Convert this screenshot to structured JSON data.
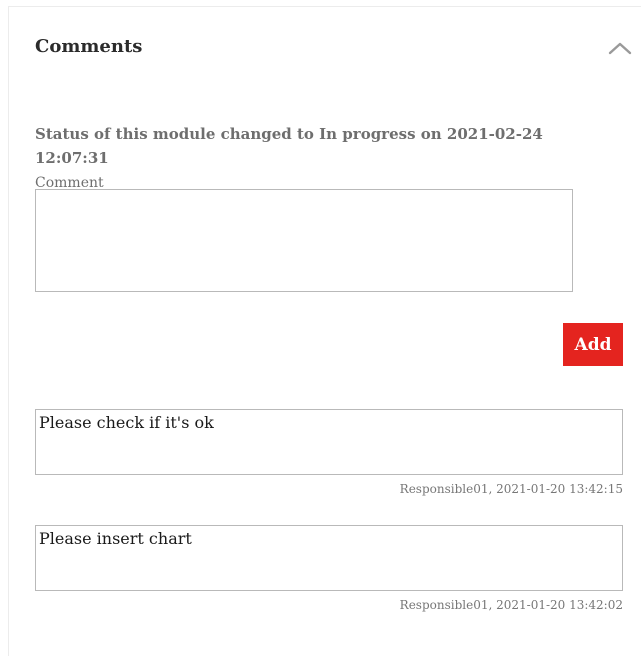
{
  "panel": {
    "title": "Comments",
    "toggle_icon": "chevron-up-icon"
  },
  "status": {
    "line1": "Status of this module changed to In progress on 2021-02-24",
    "line2": "12:07:31"
  },
  "form": {
    "comment_label": "Comment",
    "comment_value": "",
    "add_label": "Add",
    "add_color": "#e4241f"
  },
  "comments": [
    {
      "text": "Please check if it's ok",
      "meta": "Responsible01, 2021-01-20 13:42:15"
    },
    {
      "text": "Please insert chart",
      "meta": "Responsible01, 2021-01-20 13:42:02"
    }
  ]
}
